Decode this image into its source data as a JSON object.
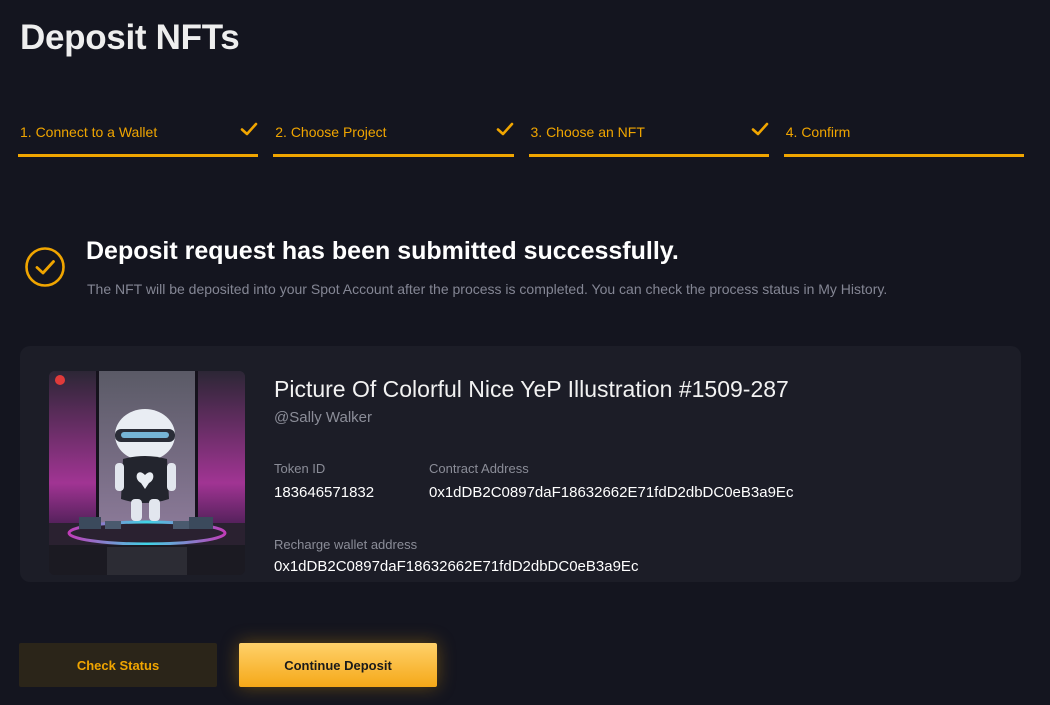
{
  "page": {
    "title": "Deposit NFTs"
  },
  "steps": [
    {
      "label": "1. Connect to a Wallet",
      "done": true
    },
    {
      "label": "2. Choose Project",
      "done": true
    },
    {
      "label": "3. Choose an NFT",
      "done": true
    },
    {
      "label": "4. Confirm",
      "done": false
    }
  ],
  "success": {
    "title": "Deposit request has been submitted successfully.",
    "description": "The NFT will be deposited into your Spot Account after the process is completed. You can check the process status in My History."
  },
  "nft": {
    "name": "Picture Of Colorful Nice YeP Illustration #1509-287",
    "creator": "@Sally Walker",
    "token_id_label": "Token ID",
    "token_id": "183646571832",
    "contract_label": "Contract Address",
    "contract_address": "0x1dDB2C0897daF18632662E71fdD2dbDC0eB3a9Ec",
    "recharge_label": "Recharge wallet address",
    "recharge_address": "0x1dDB2C0897daF18632662E71fdD2dbDC0eB3a9Ec"
  },
  "buttons": {
    "check_status": "Check Status",
    "continue_deposit": "Continue Deposit"
  },
  "colors": {
    "accent": "#f0a500",
    "background": "#14151f",
    "card": "#1c1d27",
    "muted_text": "#8b8d98"
  },
  "icons": {
    "step_done": "check-icon",
    "success": "check-circle-icon"
  }
}
